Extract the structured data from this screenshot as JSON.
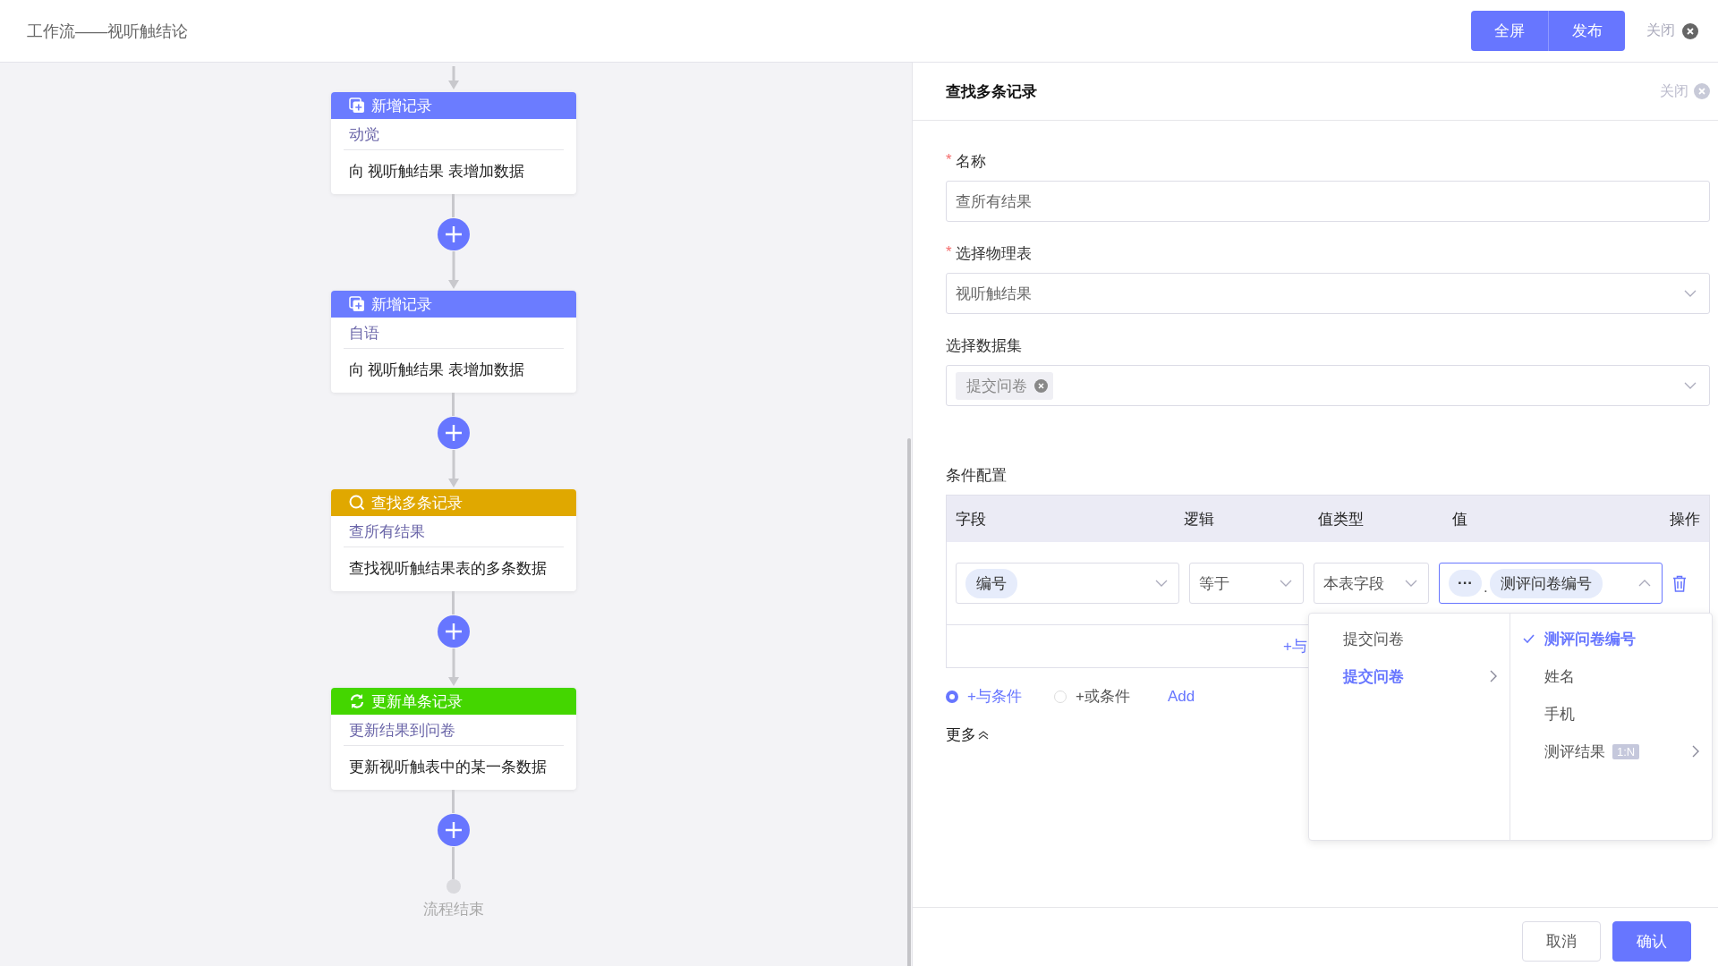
{
  "header": {
    "title": "工作流——视听触结论",
    "buttons": [
      "全屏",
      "发布"
    ],
    "close": "关闭"
  },
  "flow": {
    "nodes": [
      {
        "kind": "add",
        "title": "新增记录",
        "name": "动觉",
        "description": "向 视听触结果 表增加数据"
      },
      {
        "kind": "add",
        "title": "新增记录",
        "name": "自语",
        "description": "向 视听触结果 表增加数据"
      },
      {
        "kind": "find",
        "title": "查找多条记录",
        "name": "查所有结果",
        "description": "查找视听触结果表的多条数据"
      },
      {
        "kind": "update",
        "title": "更新单条记录",
        "name": "更新结果到问卷",
        "description": "更新视听触表中的某一条数据"
      }
    ],
    "end": "流程结束"
  },
  "panel": {
    "title": "查找多条记录",
    "close": "关闭",
    "fields": [
      {
        "kind": "input",
        "required_mark": "*",
        "label": "名称",
        "value": "查所有结果"
      },
      {
        "kind": "select",
        "required_mark": "*",
        "label": "选择物理表",
        "value": "视听触结果"
      },
      {
        "kind": "tags",
        "label": "选择数据集",
        "tags": [
          "提交问卷"
        ]
      }
    ],
    "conditions": {
      "label": "条件配置",
      "columns": [
        "字段",
        "逻辑",
        "值类型",
        "值",
        "操作"
      ],
      "rows": [
        {
          "field": "编号",
          "logic": "等于",
          "value_type": "本表字段",
          "value_parts": [
            "···",
            "测评问卷编号"
          ],
          "separator": ".",
          "expanded": true
        }
      ],
      "add_row": "+与"
    },
    "modes": [
      {
        "label": "+与条件",
        "selected": true
      },
      {
        "label": "+或条件",
        "selected": false
      }
    ],
    "add_link": "Add",
    "more": "更多"
  },
  "cascader": {
    "columns": [
      [
        {
          "label": "提交问卷",
          "selected": false,
          "has_children": false
        },
        {
          "label": "提交问卷",
          "selected": true,
          "has_children": true
        }
      ],
      [
        {
          "label": "测评问卷编号",
          "selected": true,
          "has_children": false
        },
        {
          "label": "姓名",
          "selected": false,
          "has_children": false
        },
        {
          "label": "手机",
          "selected": false,
          "has_children": false
        },
        {
          "label": "测评结果",
          "selected": false,
          "has_children": true,
          "badge": "1:N"
        }
      ]
    ]
  },
  "footer": {
    "buttons": [
      {
        "label": "取消",
        "kind": "secondary"
      },
      {
        "label": "确认",
        "kind": "primary"
      }
    ]
  }
}
